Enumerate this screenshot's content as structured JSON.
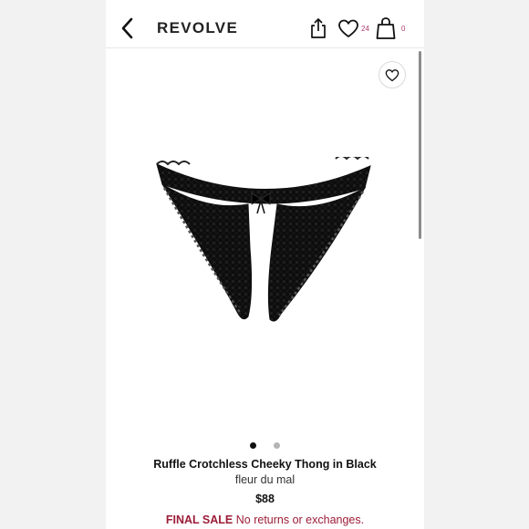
{
  "header": {
    "brand": "REVOLVE",
    "wishlist_count": "24",
    "bag_count": "0",
    "icons": {
      "back": "chevron-left-icon",
      "share": "share-icon",
      "wishlist": "heart-icon",
      "bag": "shopping-bag-icon"
    }
  },
  "product": {
    "name": "Ruffle Crotchless Cheeky Thong in Black",
    "brand": "fleur du mal",
    "price": "$88",
    "sale_label": "FINAL SALE",
    "sale_note": "No returns or exchanges.",
    "favorite_icon": "heart-outline-icon",
    "image_count": 2,
    "active_image_index": 0
  },
  "colors": {
    "brand_text": "#222222",
    "badge": "#b03a6e",
    "sale": "#9c1c37",
    "active_dot": "#111111",
    "inactive_dot": "#b5b5b5"
  }
}
